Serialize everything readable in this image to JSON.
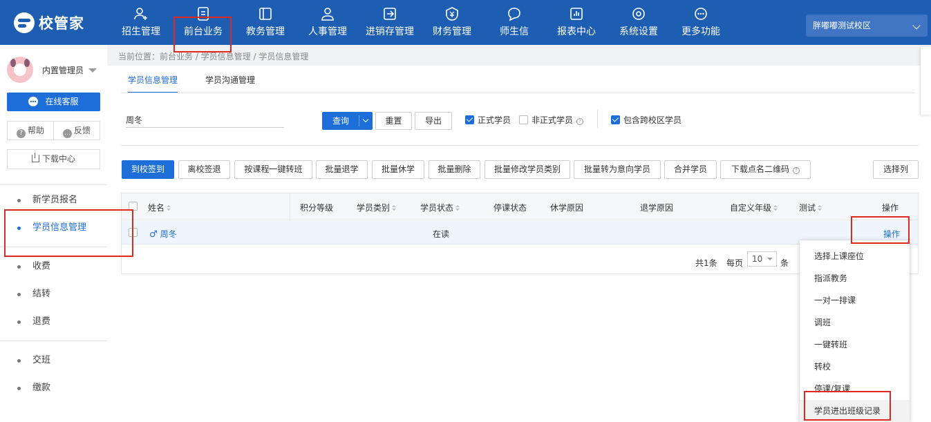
{
  "brand": {
    "name": "校管家"
  },
  "nav": {
    "items": [
      {
        "label": "招生管理",
        "icon": "user-add-icon"
      },
      {
        "label": "前台业务",
        "icon": "document-icon"
      },
      {
        "label": "教务管理",
        "icon": "book-icon"
      },
      {
        "label": "人事管理",
        "icon": "person-icon"
      },
      {
        "label": "进销存管理",
        "icon": "inventory-icon"
      },
      {
        "label": "财务管理",
        "icon": "yen-shield-icon"
      },
      {
        "label": "师生信",
        "icon": "chat-icon"
      },
      {
        "label": "报表中心",
        "icon": "bar-chart-icon"
      },
      {
        "label": "系统设置",
        "icon": "settings-icon"
      },
      {
        "label": "更多功能",
        "icon": "more-icon"
      }
    ],
    "campus": "胖嘟嘟测试校区"
  },
  "sidebar": {
    "username": "内置管理员",
    "online_service": "在线客服",
    "help": "帮助",
    "feedback": "反馈",
    "download_center": "下载中心",
    "items": [
      {
        "label": "新学员报名"
      },
      {
        "label": "学员信息管理",
        "active": true
      },
      {
        "label": "收费"
      },
      {
        "label": "结转"
      },
      {
        "label": "退费"
      },
      {
        "label": "交班"
      },
      {
        "label": "缴款"
      }
    ]
  },
  "breadcrumb": "当前位置：前台业务 / 学员信息管理 / 学员信息管理",
  "tabs": [
    {
      "label": "学员信息管理",
      "active": true
    },
    {
      "label": "学员沟通管理",
      "active": false
    }
  ],
  "search": {
    "value": "周冬",
    "query_label": "查询",
    "reset_label": "重置",
    "export_label": "导出",
    "filters": [
      {
        "label": "正式学员",
        "checked": true
      },
      {
        "label": "非正式学员",
        "checked": false
      },
      {
        "label": "包含跨校区学员",
        "checked": true
      }
    ]
  },
  "actions": [
    "到校签到",
    "离校签退",
    "按课程一键转班",
    "批量退学",
    "批量休学",
    "批量删除",
    "批量修改学员类别",
    "批量转为意向学员",
    "合并学员",
    "下载点名二维码"
  ],
  "select_columns_label": "选择列",
  "table": {
    "headers": [
      "姓名",
      "积分等级",
      "学员类别",
      "学员状态",
      "停课状态",
      "休学原因",
      "退学原因",
      "自定义年级",
      "测试",
      "操作"
    ],
    "rows": [
      {
        "name": "周冬",
        "status": "在读",
        "op": "操作"
      }
    ]
  },
  "pagination": {
    "total": "共1条",
    "per_page": "每页",
    "per_page_value": "10",
    "unit": "条"
  },
  "op_menu": {
    "items": [
      "选择上课座位",
      "指派教务",
      "一对一排课",
      "调班",
      "一键转班",
      "转校",
      "停课/复课",
      "学员进出班级记录"
    ]
  },
  "colors": {
    "primary": "#1d6ed8",
    "header_bg": "#1d5eb3",
    "highlight": "#e0281e"
  }
}
